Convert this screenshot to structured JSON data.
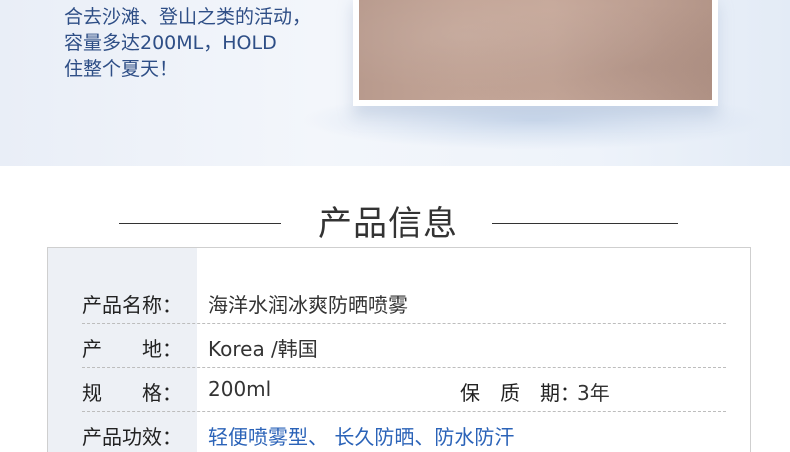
{
  "promo": {
    "lines": [
      "合去沙滩、登山之类的活动，",
      "容量多达200ML，HOLD",
      "住整个夏天！"
    ]
  },
  "section": {
    "title": "产品信息"
  },
  "table": {
    "rows": [
      {
        "label": "产品名称：",
        "value": "海洋水润冰爽防晒喷雾"
      },
      {
        "label": "产　　地：",
        "value": "Korea /韩国"
      },
      {
        "label": "规　　格：",
        "value": "200ml",
        "label2": "保　质　期：",
        "value2": "3年"
      },
      {
        "label": "产品功效：",
        "value": "轻便喷雾型、 长久防晒、防水防汗"
      }
    ]
  },
  "colors": {
    "accent_text": "#2e4e86",
    "benefit_text": "#2b63b8",
    "label_column_bg": "#edf0f5"
  }
}
